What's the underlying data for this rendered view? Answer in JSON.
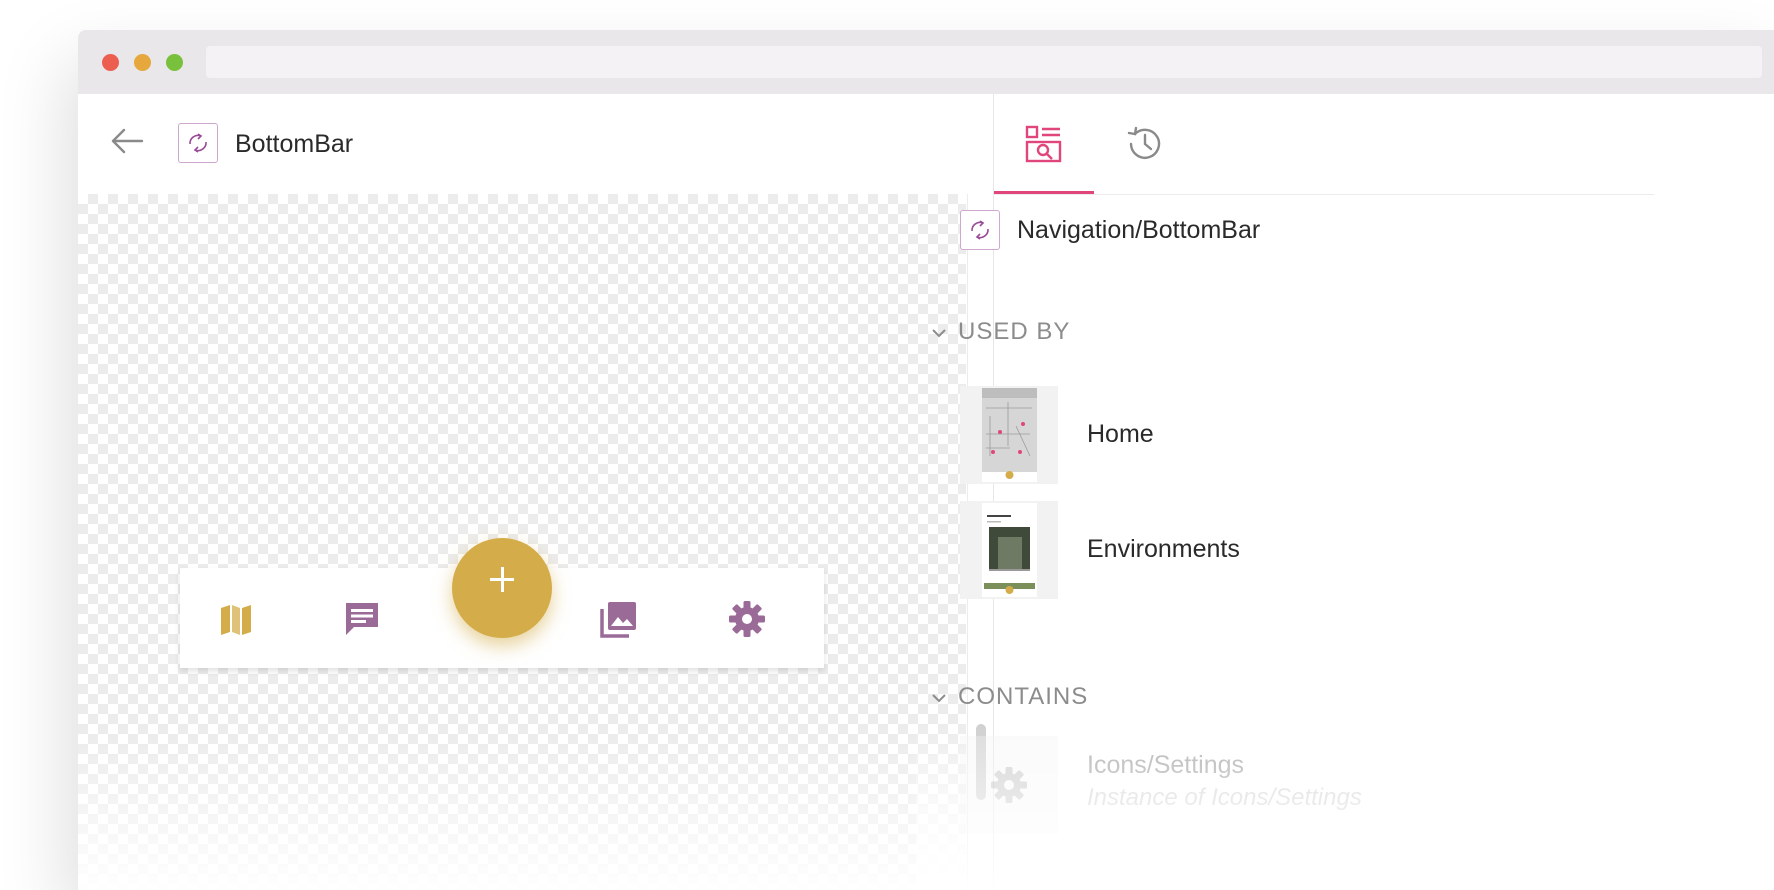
{
  "window": {
    "traffic_lights": [
      "close",
      "minimize",
      "maximize"
    ],
    "colors": {
      "close": "#ec5f50",
      "minimize": "#e6a73c",
      "maximize": "#79c13d"
    }
  },
  "left_panel": {
    "title": "BottomBar",
    "back_icon": "arrow-left-icon",
    "component_icon": "component-sync-icon"
  },
  "preview": {
    "bottom_bar": {
      "items": [
        {
          "name": "map",
          "icon": "map-icon",
          "color": "#d4ad4a"
        },
        {
          "name": "chat",
          "icon": "message-icon",
          "color": "#9a6b97"
        },
        {
          "name": "add",
          "icon": "plus-icon",
          "color": "#d4ad4a"
        },
        {
          "name": "photos",
          "icon": "photo-library-icon",
          "color": "#9a6b97"
        },
        {
          "name": "settings",
          "icon": "gear-icon",
          "color": "#9a6b97"
        }
      ]
    }
  },
  "right_panel": {
    "tabs": [
      {
        "name": "inspect",
        "icon": "inspect-icon",
        "active": true
      },
      {
        "name": "history",
        "icon": "history-icon",
        "active": false
      }
    ],
    "accent_color": "#e0467c",
    "component_path": "Navigation/BottomBar",
    "used_by": {
      "header": "USED BY",
      "items": [
        {
          "label": "Home"
        },
        {
          "label": "Environments"
        }
      ]
    },
    "contains": {
      "header": "CONTAINS",
      "items": [
        {
          "label": "Icons/Settings",
          "sublabel": "Instance of Icons/Settings"
        }
      ]
    }
  }
}
